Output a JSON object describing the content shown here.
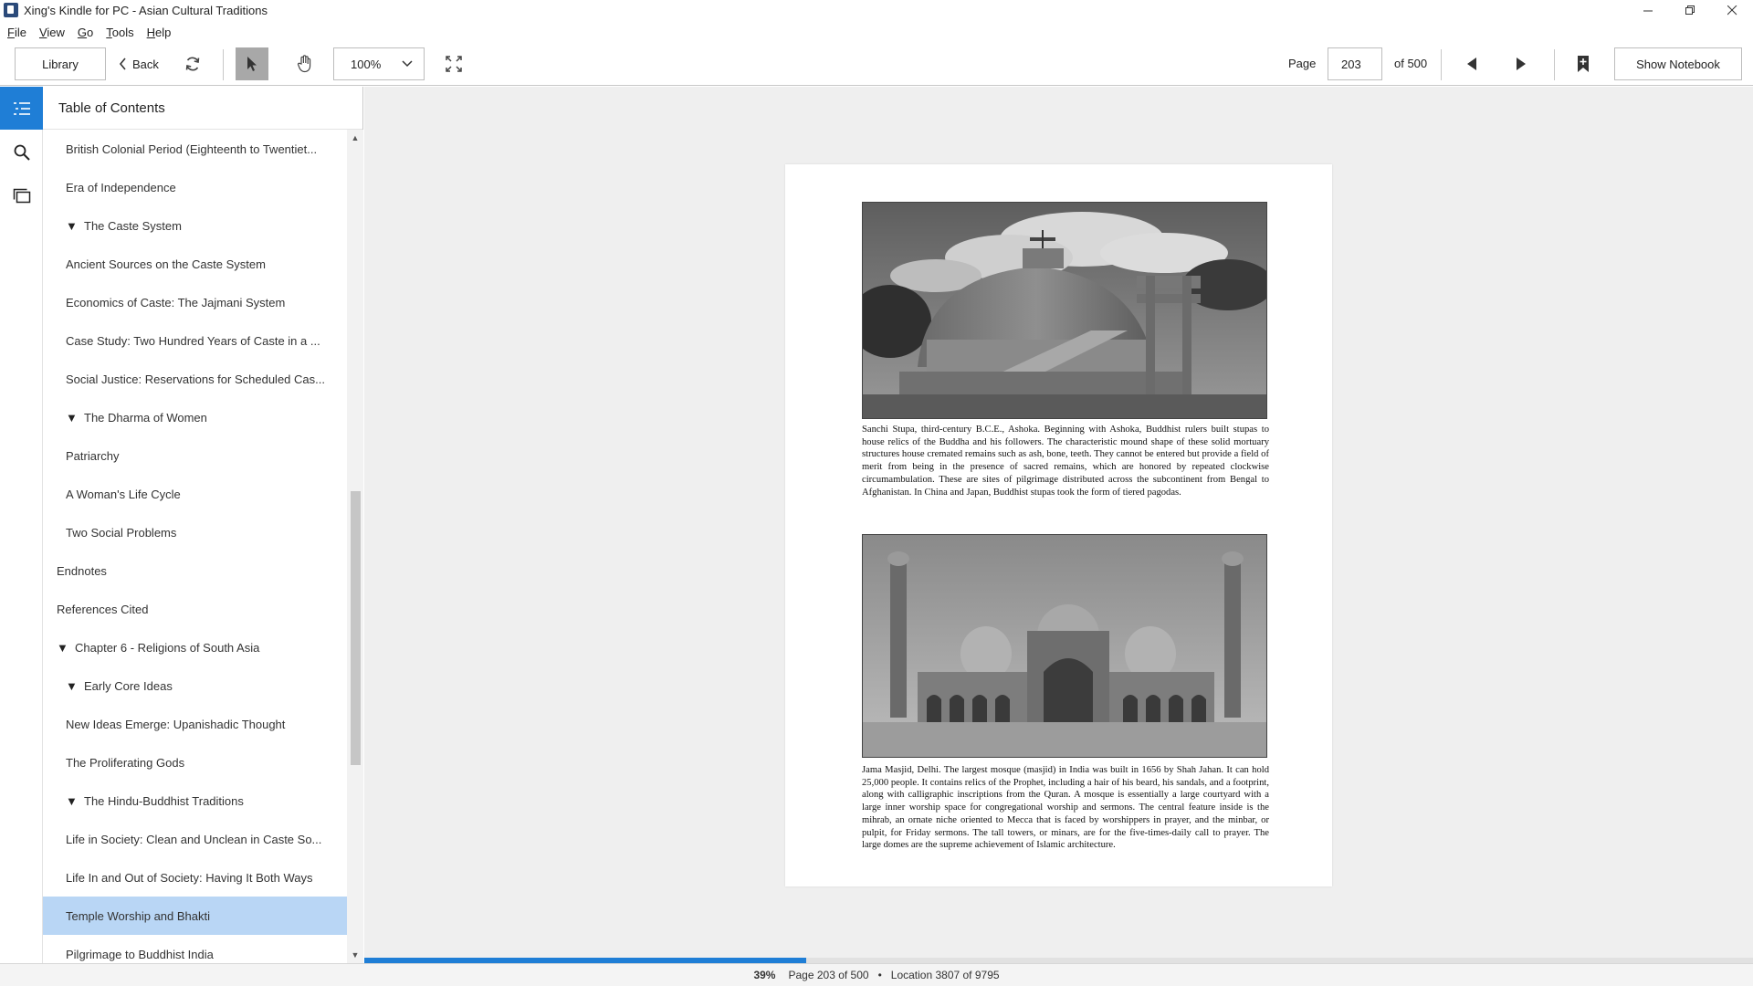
{
  "window": {
    "title": "Xing's Kindle for PC - Asian Cultural Traditions"
  },
  "menu": {
    "items": [
      {
        "accel": "F",
        "rest": "ile"
      },
      {
        "accel": "V",
        "rest": "iew"
      },
      {
        "accel": "G",
        "rest": "o"
      },
      {
        "accel": "T",
        "rest": "ools"
      },
      {
        "accel": "H",
        "rest": "elp"
      }
    ]
  },
  "toolbar": {
    "library_label": "Library",
    "back_label": "Back",
    "zoom_value": "100%",
    "page_label": "Page",
    "page_value": "203",
    "page_of": "of 500",
    "notebook_label": "Show Notebook"
  },
  "toc": {
    "header": "Table of Contents",
    "items": [
      {
        "label": "British Colonial Period (Eighteenth to Twentiet...",
        "level": 2,
        "arrow": ""
      },
      {
        "label": "Era of Independence",
        "level": 2,
        "arrow": ""
      },
      {
        "label": "The Caste System",
        "level": 1,
        "arrow": "▼"
      },
      {
        "label": "Ancient Sources on the Caste System",
        "level": 2,
        "arrow": ""
      },
      {
        "label": "Economics of Caste: The Jajmani System",
        "level": 2,
        "arrow": ""
      },
      {
        "label": "Case Study: Two Hundred Years of Caste in a ...",
        "level": 2,
        "arrow": ""
      },
      {
        "label": "Social Justice: Reservations for Scheduled Cas...",
        "level": 2,
        "arrow": ""
      },
      {
        "label": "The Dharma of Women",
        "level": 1,
        "arrow": "▼"
      },
      {
        "label": "Patriarchy",
        "level": 2,
        "arrow": ""
      },
      {
        "label": "A Woman's Life Cycle",
        "level": 2,
        "arrow": ""
      },
      {
        "label": "Two Social Problems",
        "level": 2,
        "arrow": ""
      },
      {
        "label": "Endnotes",
        "level": 0,
        "arrow": ""
      },
      {
        "label": "References Cited",
        "level": 0,
        "arrow": ""
      },
      {
        "label": "Chapter 6 - Religions of South Asia",
        "level": 0,
        "arrow": "▼"
      },
      {
        "label": "Early Core Ideas",
        "level": 1,
        "arrow": "▼"
      },
      {
        "label": "New Ideas Emerge: Upanishadic Thought",
        "level": 2,
        "arrow": ""
      },
      {
        "label": "The Proliferating Gods",
        "level": 2,
        "arrow": ""
      },
      {
        "label": "The Hindu-Buddhist Traditions",
        "level": 1,
        "arrow": "▼"
      },
      {
        "label": "Life in Society: Clean and Unclean in Caste So...",
        "level": 2,
        "arrow": ""
      },
      {
        "label": "Life In and Out of Society: Having It Both Ways",
        "level": 2,
        "arrow": ""
      },
      {
        "label": "Temple Worship and Bhakti",
        "level": 2,
        "arrow": "",
        "selected": true
      },
      {
        "label": "Pilgrimage to Buddhist India",
        "level": 2,
        "arrow": ""
      }
    ]
  },
  "page": {
    "caption_stupa": "Sanchi Stupa, third-century B.C.E., Ashoka. Beginning with Ashoka, Buddhist rulers built stupas to house relics of the Buddha and his followers. The characteristic mound shape of these solid mortuary structures house cremated remains such as ash, bone, teeth. They cannot be entered but provide a field of merit from being in the presence of sacred remains, which are honored by repeated clockwise circumambulation. These are sites of pilgrimage distributed across the subcontinent from Bengal to Afghanistan. In China and Japan, Buddhist stupas took the form of tiered pagodas.",
    "caption_mosque": "Jama Masjid, Delhi. The largest mosque (masjid) in India was built in 1656 by Shah Jahan. It can hold 25,000 people. It contains relics of the Prophet, including a hair of his beard, his sandals, and a footprint, along with calligraphic inscriptions from the Quran. A mosque is essentially a large courtyard with a large inner worship space for congregational worship and sermons. The central feature inside is the mihrab, an ornate niche oriented to Mecca that is faced by worshippers in prayer, and the minbar, or pulpit, for Friday sermons. The tall towers, or minars, are for the five-times-daily call to prayer. The large domes are the supreme achievement of Islamic architecture."
  },
  "progress": {
    "fraction": 0.318
  },
  "status": {
    "percent": "39%",
    "page": "Page 203 of 500",
    "dot": "•",
    "location": "Location 3807 of 9795"
  },
  "colors": {
    "accent": "#1f7ed6",
    "selected_row": "#b9d6f5"
  },
  "icons": {
    "app": "kindle-app-icon",
    "back": "chevron-left-icon",
    "sync": "sync-icon",
    "select": "pointer-icon",
    "hand": "hand-icon",
    "zoom": "chevron-down-icon",
    "fullscreen": "fullscreen-icon",
    "prev": "triangle-left-icon",
    "next": "triangle-right-icon",
    "bookmark": "bookmark-icon",
    "toc": "toc-list-icon",
    "search": "search-icon",
    "notes": "notes-icon"
  }
}
